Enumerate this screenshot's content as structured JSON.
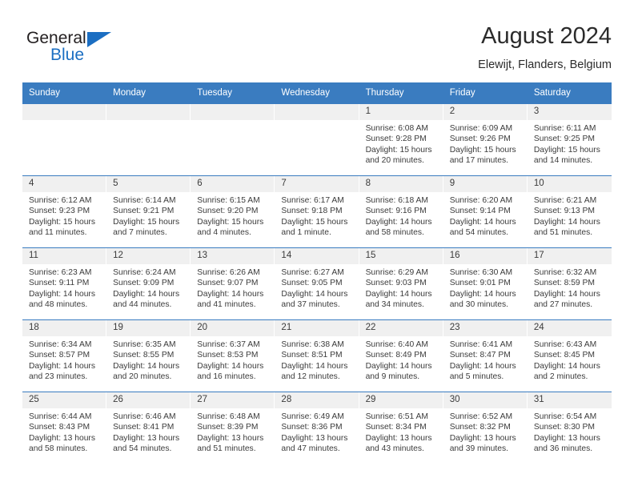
{
  "brand": {
    "name_part1": "General",
    "name_part2": "Blue"
  },
  "header": {
    "title": "August 2024",
    "subtitle": "Elewijt, Flanders, Belgium"
  },
  "weekdays": [
    "Sunday",
    "Monday",
    "Tuesday",
    "Wednesday",
    "Thursday",
    "Friday",
    "Saturday"
  ],
  "colors": {
    "header_blue": "#3a7cc0",
    "brand_blue": "#1b6ec2",
    "day_band_gray": "#f0f0f0",
    "text": "#3b3b3b"
  },
  "weeks": [
    [
      {
        "day": "",
        "sunrise": "",
        "sunset": "",
        "daylight": "",
        "empty": true
      },
      {
        "day": "",
        "sunrise": "",
        "sunset": "",
        "daylight": "",
        "empty": true
      },
      {
        "day": "",
        "sunrise": "",
        "sunset": "",
        "daylight": "",
        "empty": true
      },
      {
        "day": "",
        "sunrise": "",
        "sunset": "",
        "daylight": "",
        "empty": true
      },
      {
        "day": "1",
        "sunrise": "Sunrise: 6:08 AM",
        "sunset": "Sunset: 9:28 PM",
        "daylight": "Daylight: 15 hours and 20 minutes."
      },
      {
        "day": "2",
        "sunrise": "Sunrise: 6:09 AM",
        "sunset": "Sunset: 9:26 PM",
        "daylight": "Daylight: 15 hours and 17 minutes."
      },
      {
        "day": "3",
        "sunrise": "Sunrise: 6:11 AM",
        "sunset": "Sunset: 9:25 PM",
        "daylight": "Daylight: 15 hours and 14 minutes."
      }
    ],
    [
      {
        "day": "4",
        "sunrise": "Sunrise: 6:12 AM",
        "sunset": "Sunset: 9:23 PM",
        "daylight": "Daylight: 15 hours and 11 minutes."
      },
      {
        "day": "5",
        "sunrise": "Sunrise: 6:14 AM",
        "sunset": "Sunset: 9:21 PM",
        "daylight": "Daylight: 15 hours and 7 minutes."
      },
      {
        "day": "6",
        "sunrise": "Sunrise: 6:15 AM",
        "sunset": "Sunset: 9:20 PM",
        "daylight": "Daylight: 15 hours and 4 minutes."
      },
      {
        "day": "7",
        "sunrise": "Sunrise: 6:17 AM",
        "sunset": "Sunset: 9:18 PM",
        "daylight": "Daylight: 15 hours and 1 minute."
      },
      {
        "day": "8",
        "sunrise": "Sunrise: 6:18 AM",
        "sunset": "Sunset: 9:16 PM",
        "daylight": "Daylight: 14 hours and 58 minutes."
      },
      {
        "day": "9",
        "sunrise": "Sunrise: 6:20 AM",
        "sunset": "Sunset: 9:14 PM",
        "daylight": "Daylight: 14 hours and 54 minutes."
      },
      {
        "day": "10",
        "sunrise": "Sunrise: 6:21 AM",
        "sunset": "Sunset: 9:13 PM",
        "daylight": "Daylight: 14 hours and 51 minutes."
      }
    ],
    [
      {
        "day": "11",
        "sunrise": "Sunrise: 6:23 AM",
        "sunset": "Sunset: 9:11 PM",
        "daylight": "Daylight: 14 hours and 48 minutes."
      },
      {
        "day": "12",
        "sunrise": "Sunrise: 6:24 AM",
        "sunset": "Sunset: 9:09 PM",
        "daylight": "Daylight: 14 hours and 44 minutes."
      },
      {
        "day": "13",
        "sunrise": "Sunrise: 6:26 AM",
        "sunset": "Sunset: 9:07 PM",
        "daylight": "Daylight: 14 hours and 41 minutes."
      },
      {
        "day": "14",
        "sunrise": "Sunrise: 6:27 AM",
        "sunset": "Sunset: 9:05 PM",
        "daylight": "Daylight: 14 hours and 37 minutes."
      },
      {
        "day": "15",
        "sunrise": "Sunrise: 6:29 AM",
        "sunset": "Sunset: 9:03 PM",
        "daylight": "Daylight: 14 hours and 34 minutes."
      },
      {
        "day": "16",
        "sunrise": "Sunrise: 6:30 AM",
        "sunset": "Sunset: 9:01 PM",
        "daylight": "Daylight: 14 hours and 30 minutes."
      },
      {
        "day": "17",
        "sunrise": "Sunrise: 6:32 AM",
        "sunset": "Sunset: 8:59 PM",
        "daylight": "Daylight: 14 hours and 27 minutes."
      }
    ],
    [
      {
        "day": "18",
        "sunrise": "Sunrise: 6:34 AM",
        "sunset": "Sunset: 8:57 PM",
        "daylight": "Daylight: 14 hours and 23 minutes."
      },
      {
        "day": "19",
        "sunrise": "Sunrise: 6:35 AM",
        "sunset": "Sunset: 8:55 PM",
        "daylight": "Daylight: 14 hours and 20 minutes."
      },
      {
        "day": "20",
        "sunrise": "Sunrise: 6:37 AM",
        "sunset": "Sunset: 8:53 PM",
        "daylight": "Daylight: 14 hours and 16 minutes."
      },
      {
        "day": "21",
        "sunrise": "Sunrise: 6:38 AM",
        "sunset": "Sunset: 8:51 PM",
        "daylight": "Daylight: 14 hours and 12 minutes."
      },
      {
        "day": "22",
        "sunrise": "Sunrise: 6:40 AM",
        "sunset": "Sunset: 8:49 PM",
        "daylight": "Daylight: 14 hours and 9 minutes."
      },
      {
        "day": "23",
        "sunrise": "Sunrise: 6:41 AM",
        "sunset": "Sunset: 8:47 PM",
        "daylight": "Daylight: 14 hours and 5 minutes."
      },
      {
        "day": "24",
        "sunrise": "Sunrise: 6:43 AM",
        "sunset": "Sunset: 8:45 PM",
        "daylight": "Daylight: 14 hours and 2 minutes."
      }
    ],
    [
      {
        "day": "25",
        "sunrise": "Sunrise: 6:44 AM",
        "sunset": "Sunset: 8:43 PM",
        "daylight": "Daylight: 13 hours and 58 minutes."
      },
      {
        "day": "26",
        "sunrise": "Sunrise: 6:46 AM",
        "sunset": "Sunset: 8:41 PM",
        "daylight": "Daylight: 13 hours and 54 minutes."
      },
      {
        "day": "27",
        "sunrise": "Sunrise: 6:48 AM",
        "sunset": "Sunset: 8:39 PM",
        "daylight": "Daylight: 13 hours and 51 minutes."
      },
      {
        "day": "28",
        "sunrise": "Sunrise: 6:49 AM",
        "sunset": "Sunset: 8:36 PM",
        "daylight": "Daylight: 13 hours and 47 minutes."
      },
      {
        "day": "29",
        "sunrise": "Sunrise: 6:51 AM",
        "sunset": "Sunset: 8:34 PM",
        "daylight": "Daylight: 13 hours and 43 minutes."
      },
      {
        "day": "30",
        "sunrise": "Sunrise: 6:52 AM",
        "sunset": "Sunset: 8:32 PM",
        "daylight": "Daylight: 13 hours and 39 minutes."
      },
      {
        "day": "31",
        "sunrise": "Sunrise: 6:54 AM",
        "sunset": "Sunset: 8:30 PM",
        "daylight": "Daylight: 13 hours and 36 minutes."
      }
    ]
  ]
}
